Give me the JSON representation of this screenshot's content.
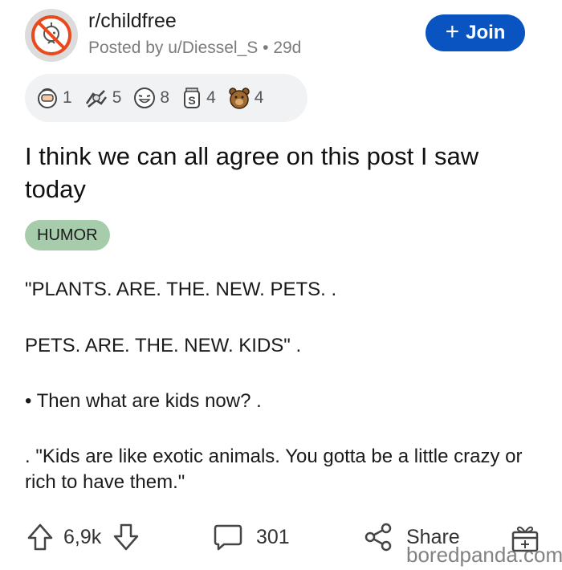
{
  "header": {
    "subreddit": "r/childfree",
    "posted_by": "Posted by u/Diessel_S",
    "age": "29d",
    "join_label": "Join"
  },
  "awards": [
    {
      "icon": "face-palm-award-icon",
      "count": "1"
    },
    {
      "icon": "wholesome-hands-award-icon",
      "count": "5"
    },
    {
      "icon": "laughing-face-award-icon",
      "count": "8"
    },
    {
      "icon": "tip-jar-award-icon",
      "count": "4"
    },
    {
      "icon": "bear-award-icon",
      "count": "4"
    }
  ],
  "post": {
    "title": "I think we can all agree on this post I saw today",
    "flair": "HUMOR",
    "body": [
      "\"PLANTS. ARE. THE. NEW. PETS. .",
      "PETS. ARE. THE. NEW. KIDS\" .",
      "• Then what are kids now? .",
      ". \"Kids are like exotic animals. You gotta be a little crazy or rich to have them.\""
    ]
  },
  "actions": {
    "upvotes": "6,9k",
    "comments": "301",
    "share_label": "Share"
  },
  "watermark": "boredpanda.com",
  "colors": {
    "join_button": "#0a54c2",
    "flair_bg": "#a7ccab",
    "awards_bg": "#f0f2f4"
  }
}
